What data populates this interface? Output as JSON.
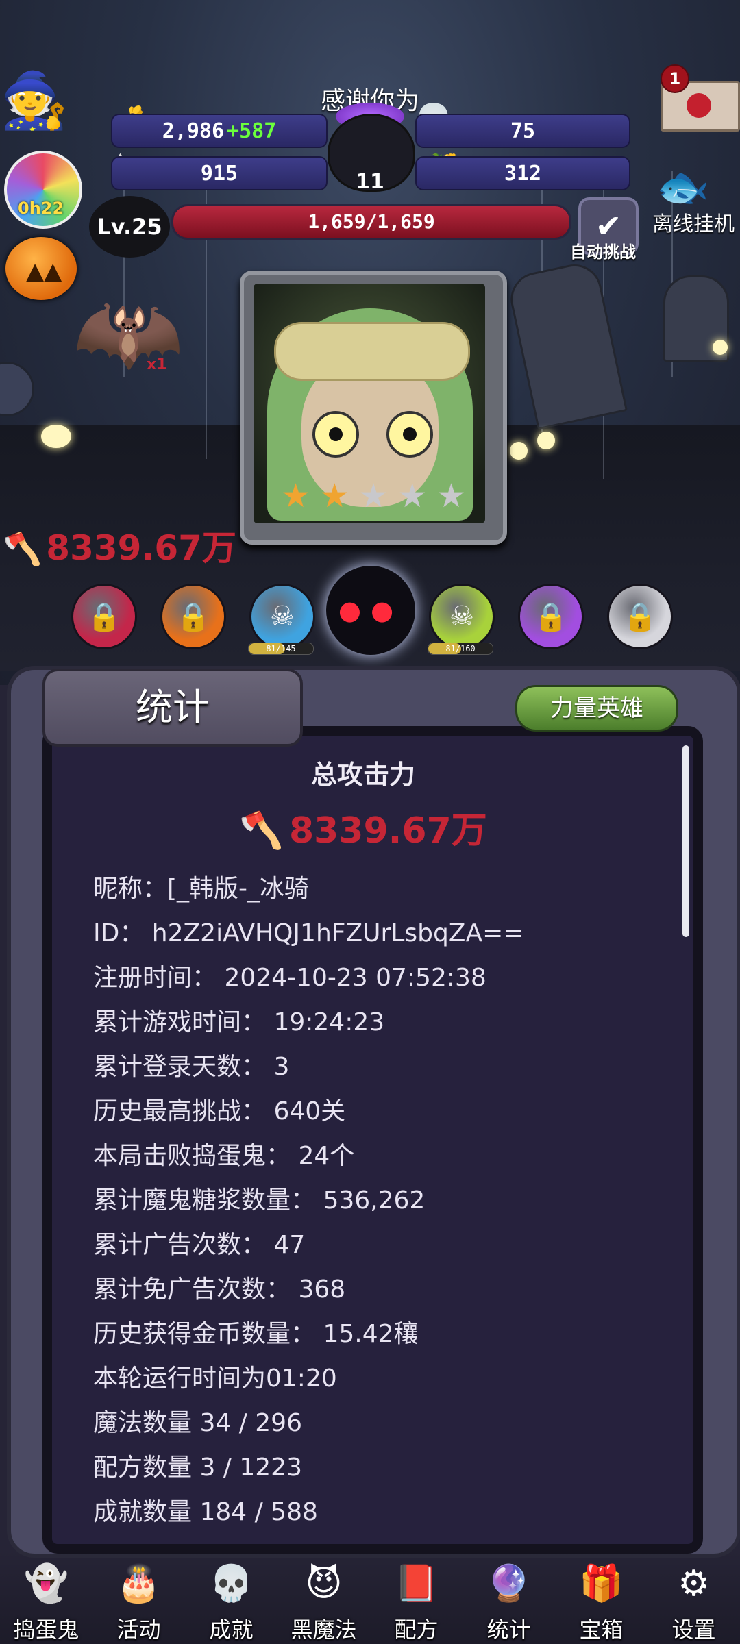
{
  "header": {
    "title": "感谢你为",
    "gold": "2,986",
    "gold_gain": "+587",
    "skull_count": "75",
    "candy_red": "915",
    "candy_corn": "312",
    "cauldron_count": "11",
    "candy_badge": "0h22",
    "mail_badge": "1",
    "offline_label": "离线挂机",
    "auto_label": "自动挑战"
  },
  "player": {
    "level": "Lv.25",
    "hp_text": "1,659/1,659",
    "hp_fraction": 1.0,
    "attack": "8339.67万",
    "stars_filled": 2,
    "stars_total": 5,
    "bat_label": "x1"
  },
  "heroes": [
    {
      "state": "locked",
      "color": "#c4264a"
    },
    {
      "state": "locked",
      "color": "#e8711a"
    },
    {
      "state": "owned",
      "color": "#3fa3e0",
      "progress": "81/145",
      "fraction": 0.56
    },
    {
      "state": "selected",
      "color": "#111"
    },
    {
      "state": "owned",
      "color": "#a8d23b",
      "progress": "81/160",
      "fraction": 0.51
    },
    {
      "state": "locked",
      "color": "#a24ee0"
    },
    {
      "state": "locked",
      "color": "#d6d6dc"
    }
  ],
  "panel": {
    "tab": "统计",
    "hero_button": "力量英雄",
    "total_label": "总攻击力",
    "total_value": "8339.67万",
    "lines": [
      "昵称：[_韩版-_冰骑",
      "ID： h2Z2iAVHQJ1hFZUrLsbqZA==",
      "注册时间： 2024-10-23 07:52:38",
      "累计游戏时间： 19:24:23",
      "累计登录天数： 3",
      "历史最高挑战： 640关",
      "本局击败捣蛋鬼： 24个",
      "累计魔鬼糖浆数量： 536,262",
      "累计广告次数： 47",
      "累计免广告次数： 368",
      "历史获得金币数量： 15.42穰",
      "本轮运行时间为01:20",
      "魔法数量 34 / 296",
      "配方数量 3 / 1223",
      "成就数量 184 / 588"
    ]
  },
  "nav": [
    {
      "label": "捣蛋鬼",
      "icon": "ghost-icon"
    },
    {
      "label": "活动",
      "icon": "eyeball-cake-icon"
    },
    {
      "label": "成就",
      "icon": "skull-trophy-icon"
    },
    {
      "label": "黑魔法",
      "icon": "demon-icon"
    },
    {
      "label": "配方",
      "icon": "recipe-book-icon"
    },
    {
      "label": "统计",
      "icon": "crystal-ball-icon"
    },
    {
      "label": "宝箱",
      "icon": "gift-box-icon"
    },
    {
      "label": "设置",
      "icon": "gear-icon"
    }
  ]
}
